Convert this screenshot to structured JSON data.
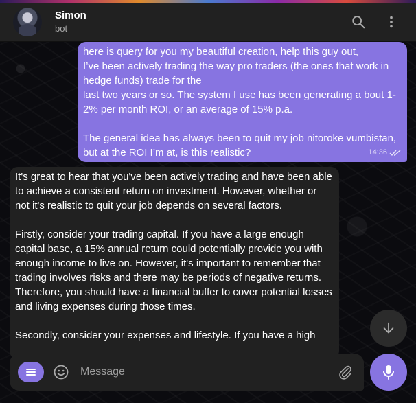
{
  "colors": {
    "accent": "#8774e1",
    "panel": "#212121",
    "text": "#ffffff",
    "muted": "#aaaaaa"
  },
  "header": {
    "title": "Simon",
    "subtitle": "bot",
    "icons": {
      "search": "search-icon",
      "more": "more-vertical-icon"
    }
  },
  "messages": {
    "outgoing": {
      "lines": [
        "here is query for you my beautiful creation, help this guy out,",
        "I’ve been actively trading the way pro traders (the ones that work in hedge funds) trade for the",
        "last two years or so. The system I use has been generating a bout 1-2% per month ROI, or an average of 15% p.a.",
        "",
        "The general idea has always been to quit my job nitoroke vumbistan, but at the ROI I’m at, is this realistic?"
      ],
      "time": "14:36",
      "status_icon": "double-check-icon"
    },
    "incoming": {
      "paragraphs": [
        "It's great to hear that you've been actively trading and have been able to achieve a consistent return on investment. However, whether or not it's realistic to quit your job depends on several factors.",
        "Firstly, consider your trading capital. If you have a large enough capital base, a 15% annual return could potentially provide you with enough income to live on. However, it's important to remember that trading involves risks and there may be periods of negative returns. Therefore, you should have a financial buffer to cover potential losses and living expenses during those times.",
        "Secondly, consider your expenses and lifestyle. If you have a high"
      ]
    }
  },
  "composer": {
    "placeholder": "Message",
    "icons": {
      "menu": "menu-icon",
      "emoji": "emoji-icon",
      "attach": "paperclip-icon",
      "mic": "microphone-icon",
      "scroll": "arrow-down-icon"
    }
  }
}
